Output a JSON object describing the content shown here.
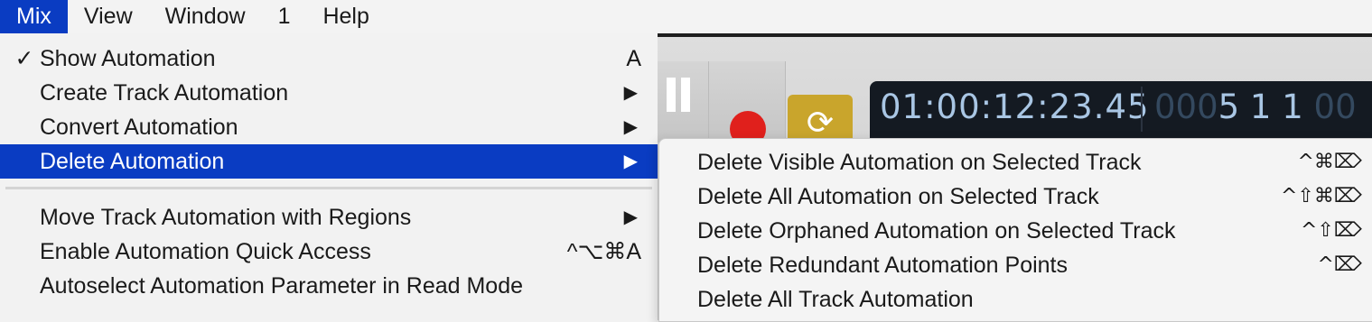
{
  "menubar": {
    "items": [
      "Mix",
      "View",
      "Window",
      "1",
      "Help"
    ],
    "active": "Mix"
  },
  "transport": {
    "timecode": "01:00:12:23.45",
    "bars_dim": "000",
    "bars_bright": "5 1 1",
    "bars_tail": "00",
    "cycle_icon": "cycle-icon"
  },
  "mix_menu": {
    "items": [
      {
        "check": "✓",
        "label": "Show Automation",
        "shortcut": "A",
        "arrow": ""
      },
      {
        "check": "",
        "label": "Create Track Automation",
        "shortcut": "",
        "arrow": "▶"
      },
      {
        "check": "",
        "label": "Convert Automation",
        "shortcut": "",
        "arrow": "▶"
      },
      {
        "check": "",
        "label": "Delete Automation",
        "shortcut": "",
        "arrow": "▶"
      },
      {
        "check": "",
        "label": "Move Track Automation with Regions",
        "shortcut": "",
        "arrow": "▶"
      },
      {
        "check": "",
        "label": "Enable Automation Quick Access",
        "shortcut": "^⌥⌘A",
        "arrow": ""
      },
      {
        "check": "",
        "label": "Autoselect Automation Parameter in Read Mode",
        "shortcut": "",
        "arrow": ""
      }
    ]
  },
  "delete_submenu": {
    "items": [
      {
        "label": "Delete Visible Automation on Selected Track",
        "shortcut": "^⌘⌦"
      },
      {
        "label": "Delete All Automation on Selected Track",
        "shortcut": "^⇧⌘⌦"
      },
      {
        "label": "Delete Orphaned Automation on Selected Track",
        "shortcut": "^⇧⌦"
      },
      {
        "label": "Delete Redundant Automation Points",
        "shortcut": "^⌦"
      },
      {
        "label": "Delete All Track Automation",
        "shortcut": ""
      }
    ]
  },
  "colors": {
    "highlight": "#0a3cc2",
    "record": "#e0201c",
    "cycle": "#c9a52c",
    "lcd_bg": "#141a22",
    "lcd_text": "#a9c6e4"
  }
}
